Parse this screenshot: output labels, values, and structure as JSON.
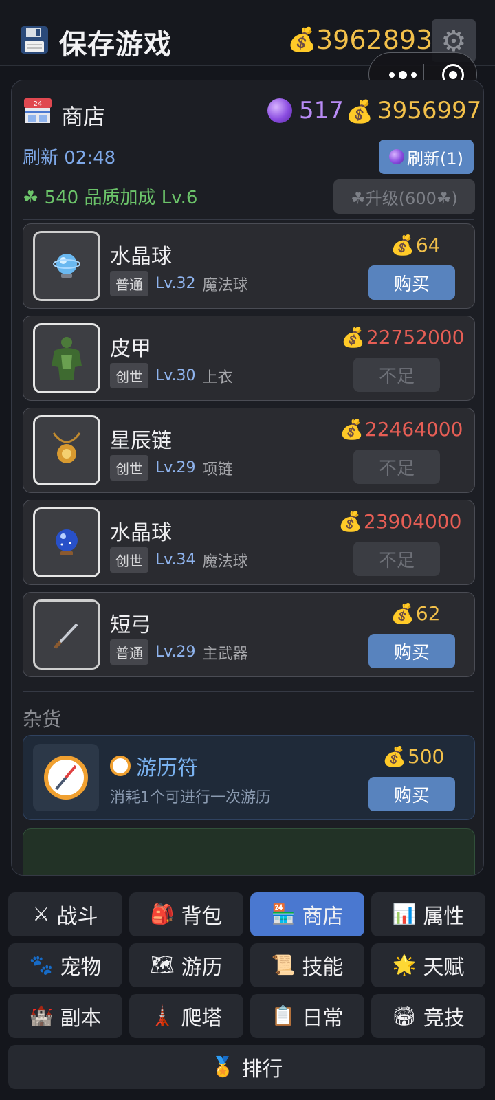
{
  "topbar": {
    "save_label": "保存游戏",
    "gold": "3962893"
  },
  "shop": {
    "title": "商店",
    "crystals": "517",
    "gold": "3956997",
    "refresh_timer": "刷新 02:48",
    "refresh_button": "刷新(1)",
    "clover_line": "☘ 540  品质加成 Lv.6",
    "upgrade_button": "☘升级(600☘)",
    "items": [
      {
        "name": "水晶球",
        "rarity": "普通",
        "level": "Lv.32",
        "kind": "魔法球",
        "price": "64",
        "action": "购买"
      },
      {
        "name": "皮甲",
        "rarity": "创世",
        "level": "Lv.30",
        "kind": "上衣",
        "price": "22752000",
        "action": "不足"
      },
      {
        "name": "星辰链",
        "rarity": "创世",
        "level": "Lv.29",
        "kind": "项链",
        "price": "22464000",
        "action": "不足"
      },
      {
        "name": "水晶球",
        "rarity": "创世",
        "level": "Lv.34",
        "kind": "魔法球",
        "price": "23904000",
        "action": "不足"
      },
      {
        "name": "短弓",
        "rarity": "普通",
        "level": "Lv.29",
        "kind": "主武器",
        "price": "62",
        "action": "购买"
      }
    ],
    "misc_title": "杂货",
    "misc_item": {
      "name": "游历符",
      "desc": "消耗1个可进行一次游历",
      "price": "500",
      "action": "购买"
    }
  },
  "nav": {
    "battle": "战斗",
    "bag": "背包",
    "shop": "商店",
    "stats": "属性",
    "pet": "宠物",
    "travel": "游历",
    "skills": "技能",
    "talent": "天赋",
    "dungeon": "副本",
    "tower": "爬塔",
    "daily": "日常",
    "arena": "竞技",
    "ranking": "排行"
  },
  "colors": {
    "gold": "#f2c04a",
    "crystal": "#b98cf6",
    "insufficient": "#e65e55",
    "buy_button": "#5883be",
    "active_tab": "#4a78d0",
    "clover": "#6cc46a"
  }
}
